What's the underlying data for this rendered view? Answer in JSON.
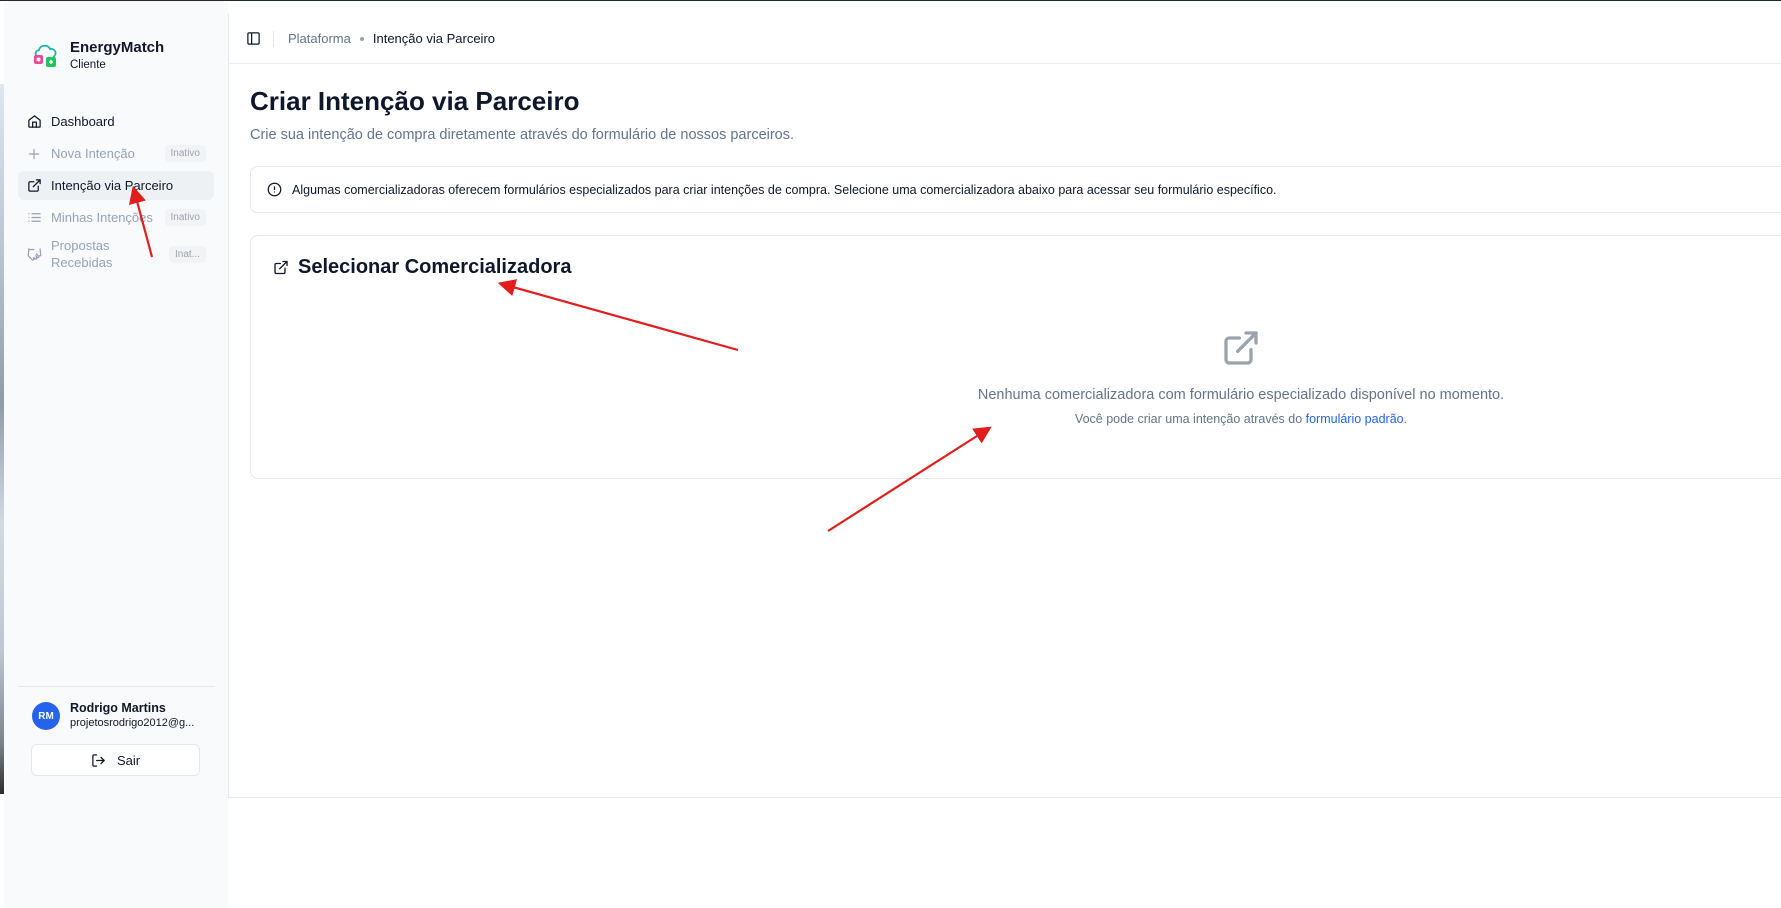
{
  "brand": {
    "name": "EnergyMatch",
    "role": "Cliente",
    "logo_icon": "energy-logo-icon"
  },
  "sidebar": {
    "items": [
      {
        "label": "Dashboard",
        "icon": "home-icon",
        "active": false,
        "disabled": false,
        "badge": ""
      },
      {
        "label": "Nova Intenção",
        "icon": "plus-icon",
        "active": false,
        "disabled": true,
        "badge": "Inativo"
      },
      {
        "label": "Intenção via Parceiro",
        "icon": "external-link-icon",
        "active": true,
        "disabled": false,
        "badge": ""
      },
      {
        "label": "Minhas Intenções",
        "icon": "list-icon",
        "active": false,
        "disabled": true,
        "badge": "Inativo"
      },
      {
        "label": "Propostas Recebidas",
        "icon": "handshake-icon",
        "active": false,
        "disabled": true,
        "badge": "Inat..."
      }
    ]
  },
  "user": {
    "initials": "RM",
    "name": "Rodrigo Martins",
    "email": "projetosrodrigo2012@g...",
    "logout_label": "Sair"
  },
  "header": {
    "breadcrumb_root": "Plataforma",
    "breadcrumb_current": "Intenção via Parceiro"
  },
  "main": {
    "title": "Criar Intenção via Parceiro",
    "subtitle": "Crie sua intenção de compra diretamente através do formulário de nossos parceiros.",
    "alert_text": "Algumas comercializadoras oferecem formulários especializados para criar intenções de compra. Selecione uma comercializadora abaixo para acessar seu formulário específico.",
    "card": {
      "title": "Selecionar Comercializadora",
      "empty_message": "Nenhuma comercializadora com formulário especializado disponível no momento.",
      "empty_hint_prefix": "Você pode criar uma intenção através do ",
      "empty_hint_link": "formulário padrão",
      "empty_hint_suffix": "."
    }
  },
  "colors": {
    "accent": "#2563eb",
    "annotation_arrow": "#e11d1d",
    "active_bg": "#eef1f4",
    "muted_text": "#64748b"
  }
}
